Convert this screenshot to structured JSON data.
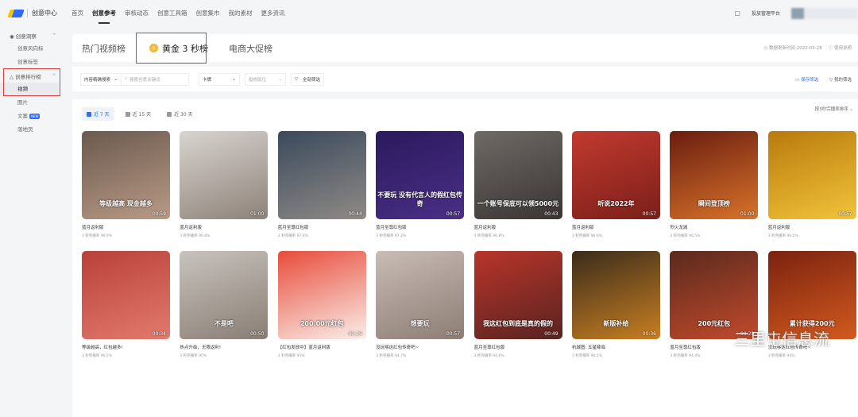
{
  "header": {
    "app_title": "创意中心",
    "nav": [
      "首页",
      "创意参考",
      "审核动态",
      "创意工具箱",
      "创意集市",
      "我的素材",
      "更多资讯"
    ],
    "active_nav": 1,
    "platform_label": "投放管理平台"
  },
  "sidebar": {
    "groups": [
      {
        "label": "创意洞察",
        "items": [
          "创意风向标",
          "创意标签"
        ]
      },
      {
        "label": "创意排行榜",
        "items": [
          "视频",
          "图片",
          "文案",
          "落地页"
        ]
      }
    ],
    "new_badge": "NEW"
  },
  "tabs": {
    "items": [
      "热门视频榜",
      "黄金 3 秒榜",
      "电商大促榜"
    ],
    "update_time": "数据更新时间 2022-03-28",
    "help": "使用说明"
  },
  "filters": {
    "content_search": "内容精确搜索",
    "search_placeholder": "搜索创意关键词",
    "card": "卡牌",
    "placement": "投放版位",
    "all_filters": "全部筛选",
    "save_filter": "保存筛选",
    "my_filter": "我的筛选"
  },
  "ranges": [
    "近 7 天",
    "近 15 天",
    "近 30 天"
  ],
  "sort_label": "按3秒完播率排序",
  "rate_prefix": "3 秒完播率",
  "videos": [
    {
      "title": "蓝月返利版",
      "rate": "96.9%",
      "duration": "00:59",
      "caption": "等级越高 现金越多",
      "c1": "#6b5a4e",
      "c2": "#b99a86"
    },
    {
      "title": "蓝月返利版",
      "rate": "96.8%",
      "duration": "01:00",
      "caption": "",
      "c1": "#d8d4cf",
      "c2": "#8e8279"
    },
    {
      "title": "蓝月至尊红包版",
      "rate": "97.9%",
      "duration": "00:44",
      "caption": "",
      "c1": "#3a4a5c",
      "c2": "#8f8a86"
    },
    {
      "title": "蓝月至尊红包版",
      "rate": "97.2%",
      "duration": "00:57",
      "caption": "不要玩 没有代言人的假红包传奇",
      "c1": "#2a1a5e",
      "c2": "#4b2f86"
    },
    {
      "title": "蓝月返利版",
      "rate": "96.8%",
      "duration": "00:43",
      "caption": "一个账号保底可以领5000元",
      "c1": "#6f6a66",
      "c2": "#3a3533"
    },
    {
      "title": "蓝月返利版",
      "rate": "96.6%",
      "duration": "00:57",
      "caption": "听说2022年",
      "c1": "#c23a2e",
      "c2": "#7b1f1a"
    },
    {
      "title": "烈火龙城",
      "rate": "96.5%",
      "duration": "01:00",
      "caption": "瞬间登顶榜",
      "c1": "#6a1d10",
      "c2": "#d8732a"
    },
    {
      "title": "蓝月返利版",
      "rate": "96.5%",
      "duration": "00:57",
      "caption": "",
      "c1": "#b87a0c",
      "c2": "#f2c43a"
    },
    {
      "title": "等级越高，红包越多!",
      "rate": "96.5%",
      "duration": "00:34",
      "caption": "",
      "c1": "#b9413a",
      "c2": "#e27a6d"
    },
    {
      "title": "热点升级，无限返利!",
      "rate": "95%",
      "duration": "00:50",
      "caption": "不是吧",
      "c1": "#c7c3bd",
      "c2": "#8a7e74"
    },
    {
      "title": "【红包发放中】蓝月返利版",
      "rate": "95%",
      "duration": "00:29",
      "caption": "200.00元红包",
      "c1": "#e84b3a",
      "c2": "#fbeee9"
    },
    {
      "title": "没玩够这红包传奇吧~",
      "rate": "94.7%",
      "duration": "00:57",
      "caption": "想要玩",
      "c1": "#c8bcb4",
      "c2": "#8d7d75"
    },
    {
      "title": "蓝月至尊红包版",
      "rate": "94.6%",
      "duration": "00:49",
      "caption": "我这红包到底是真的假的",
      "c1": "#b8352b",
      "c2": "#5a2320"
    },
    {
      "title": "杭城图: 五星降临",
      "rate": "94.5%",
      "duration": "00:36",
      "caption": "新版补给",
      "c1": "#3a2c1c",
      "c2": "#c87f22"
    },
    {
      "title": "蓝月至尊红包版",
      "rate": "94.4%",
      "duration": "00:29",
      "caption": "200元红包",
      "c1": "#5a2a1e",
      "c2": "#c24a2c"
    },
    {
      "title": "没玩够这红包传奇吧~",
      "rate": "94%",
      "duration": "",
      "caption": "累计获得200元",
      "c1": "#7a2210",
      "c2": "#d35a1e"
    }
  ],
  "watermark": "三里屯信息流"
}
